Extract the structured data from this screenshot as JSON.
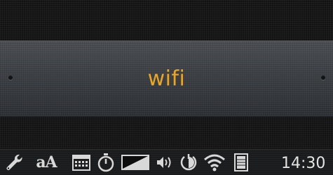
{
  "banner": {
    "title": "wifi",
    "title_color": "#e8a628"
  },
  "taskbar": {
    "icons": [
      "wrench-icon",
      "font-size-icon",
      "calendar-icon",
      "timer-icon",
      "brightness-icon",
      "volume-icon",
      "frontlight-icon",
      "wifi-icon",
      "battery-icon"
    ],
    "font_size_label": "aA",
    "clock": "14:30"
  },
  "colors": {
    "accent": "#e8a628",
    "background": "#131313",
    "banner": "#3a3d42",
    "icon": "#d8d8d8"
  }
}
